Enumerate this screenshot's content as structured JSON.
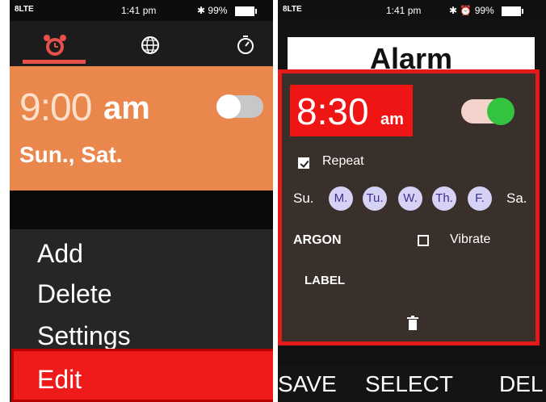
{
  "left": {
    "status": {
      "network": "8LTE",
      "time": "1:41 pm",
      "battery": "99%"
    },
    "tabs": [
      {
        "name": "alarm-tab",
        "icon": "alarm-clock-icon",
        "selected": true
      },
      {
        "name": "world-clock-tab",
        "icon": "globe-icon",
        "selected": false
      },
      {
        "name": "timer-tab",
        "icon": "stopwatch-icon",
        "selected": false
      }
    ],
    "alarm": {
      "time": "9:00",
      "ampm": "am",
      "days": "Sun., Sat.",
      "enabled": false
    },
    "menu": [
      "Add",
      "Delete",
      "Settings"
    ],
    "edit_label": "Edit",
    "colors": {
      "card": "#e9874d",
      "accent": "#e8504a",
      "highlight": "#ef1a1a"
    }
  },
  "right": {
    "status": {
      "network": "8LTE",
      "time": "1:41 pm",
      "battery": "99%"
    },
    "title": "Alarm",
    "alarm": {
      "time": "8:30",
      "ampm": "am",
      "enabled": true
    },
    "repeat_label": "Repeat",
    "repeat_checked": true,
    "days": [
      {
        "label": "Su.",
        "on": false
      },
      {
        "label": "M.",
        "on": true
      },
      {
        "label": "Tu.",
        "on": true
      },
      {
        "label": "W.",
        "on": true
      },
      {
        "label": "Th.",
        "on": true
      },
      {
        "label": "F.",
        "on": true
      },
      {
        "label": "Sa.",
        "on": false
      }
    ],
    "ringtone": "ARGON",
    "vibrate_label": "Vibrate",
    "vibrate_checked": false,
    "label_field": "LABEL",
    "softkeys": {
      "left": "SAVE",
      "center": "SELECT",
      "right": "DEL"
    },
    "colors": {
      "panel": "#3a302b",
      "highlight": "#f01515",
      "toggle_on": "#33c33e",
      "day_on": "#d6d2f6"
    }
  }
}
